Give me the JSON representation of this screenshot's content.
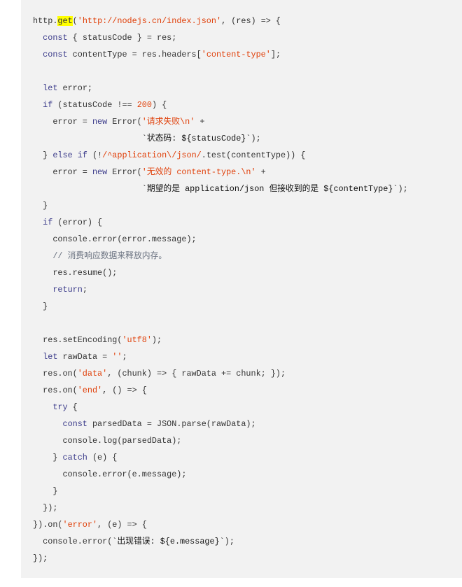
{
  "colors": {
    "keyword": "#3b3b8a",
    "string": "#e0400a",
    "comment": "#6a7280",
    "highlight": "#ffff00",
    "background": "#f2f2f2"
  },
  "code_lines": [
    [
      [
        "p",
        "http."
      ],
      [
        "hl",
        "get"
      ],
      [
        "p",
        "("
      ],
      [
        "str",
        "'http://nodejs.cn/index.json'"
      ],
      [
        "p",
        ", (res) => {"
      ]
    ],
    [
      [
        "p",
        "  "
      ],
      [
        "kw",
        "const"
      ],
      [
        "p",
        " { statusCode } = res;"
      ]
    ],
    [
      [
        "p",
        "  "
      ],
      [
        "kw",
        "const"
      ],
      [
        "p",
        " contentType = res.headers["
      ],
      [
        "str",
        "'content-type'"
      ],
      [
        "p",
        "];"
      ]
    ],
    [],
    [
      [
        "p",
        "  "
      ],
      [
        "kw",
        "let"
      ],
      [
        "p",
        " error;"
      ]
    ],
    [
      [
        "p",
        "  "
      ],
      [
        "kw",
        "if"
      ],
      [
        "p",
        " (statusCode !== "
      ],
      [
        "num",
        "200"
      ],
      [
        "p",
        ") {"
      ]
    ],
    [
      [
        "p",
        "    error = "
      ],
      [
        "kw",
        "new"
      ],
      [
        "p",
        " Error("
      ],
      [
        "str",
        "'请求失败\\n'"
      ],
      [
        "p",
        " +"
      ]
    ],
    [
      [
        "p",
        "                      "
      ],
      [
        "tpl",
        "`状态码: ${statusCode}`"
      ],
      [
        "p",
        ");"
      ]
    ],
    [
      [
        "p",
        "  } "
      ],
      [
        "kw",
        "else if"
      ],
      [
        "p",
        " (!"
      ],
      [
        "str",
        "/^application\\/json/"
      ],
      [
        "p",
        ".test(contentType)) {"
      ]
    ],
    [
      [
        "p",
        "    error = "
      ],
      [
        "kw",
        "new"
      ],
      [
        "p",
        " Error("
      ],
      [
        "str",
        "'无效的 content-type.\\n'"
      ],
      [
        "p",
        " +"
      ]
    ],
    [
      [
        "p",
        "                      "
      ],
      [
        "tpl",
        "`期望的是 application/json 但接收到的是 ${contentType}`"
      ],
      [
        "p",
        ");"
      ]
    ],
    [
      [
        "p",
        "  }"
      ]
    ],
    [
      [
        "p",
        "  "
      ],
      [
        "kw",
        "if"
      ],
      [
        "p",
        " (error) {"
      ]
    ],
    [
      [
        "p",
        "    console.error(error.message);"
      ]
    ],
    [
      [
        "p",
        "    "
      ],
      [
        "com",
        "// 消费响应数据来释放内存。"
      ]
    ],
    [
      [
        "p",
        "    res.resume();"
      ]
    ],
    [
      [
        "p",
        "    "
      ],
      [
        "kw",
        "return"
      ],
      [
        "p",
        ";"
      ]
    ],
    [
      [
        "p",
        "  }"
      ]
    ],
    [],
    [
      [
        "p",
        "  res.setEncoding("
      ],
      [
        "str",
        "'utf8'"
      ],
      [
        "p",
        ");"
      ]
    ],
    [
      [
        "p",
        "  "
      ],
      [
        "kw",
        "let"
      ],
      [
        "p",
        " rawData = "
      ],
      [
        "str",
        "''"
      ],
      [
        "p",
        ";"
      ]
    ],
    [
      [
        "p",
        "  res.on("
      ],
      [
        "str",
        "'data'"
      ],
      [
        "p",
        ", (chunk) => { rawData += chunk; });"
      ]
    ],
    [
      [
        "p",
        "  res.on("
      ],
      [
        "str",
        "'end'"
      ],
      [
        "p",
        ", () => {"
      ]
    ],
    [
      [
        "p",
        "    "
      ],
      [
        "kw",
        "try"
      ],
      [
        "p",
        " {"
      ]
    ],
    [
      [
        "p",
        "      "
      ],
      [
        "kw",
        "const"
      ],
      [
        "p",
        " parsedData = JSON.parse(rawData);"
      ]
    ],
    [
      [
        "p",
        "      console.log(parsedData);"
      ]
    ],
    [
      [
        "p",
        "    } "
      ],
      [
        "kw",
        "catch"
      ],
      [
        "p",
        " (e) {"
      ]
    ],
    [
      [
        "p",
        "      console.error(e.message);"
      ]
    ],
    [
      [
        "p",
        "    }"
      ]
    ],
    [
      [
        "p",
        "  });"
      ]
    ],
    [
      [
        "p",
        "}).on("
      ],
      [
        "str",
        "'error'"
      ],
      [
        "p",
        ", (e) => {"
      ]
    ],
    [
      [
        "p",
        "  console.error("
      ],
      [
        "tpl",
        "`出现错误: ${e.message}`"
      ],
      [
        "p",
        ");"
      ]
    ],
    [
      [
        "p",
        "});"
      ]
    ]
  ]
}
